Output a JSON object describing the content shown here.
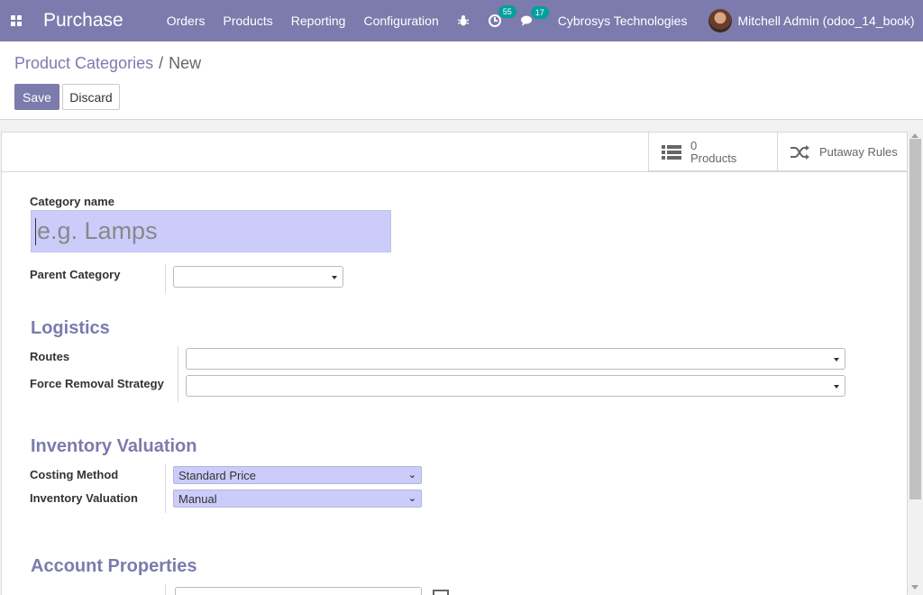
{
  "navbar": {
    "app_name": "Purchase",
    "menu": [
      "Orders",
      "Products",
      "Reporting",
      "Configuration"
    ],
    "activity_count": "55",
    "message_count": "17",
    "company": "Cybrosys Technologies",
    "user": "Mitchell Admin (odoo_14_book)"
  },
  "breadcrumb": {
    "parent": "Product Categories",
    "separator": "/",
    "current": "New"
  },
  "buttons": {
    "save": "Save",
    "discard": "Discard"
  },
  "smart_buttons": {
    "products_count": "0",
    "products_label": "Products",
    "putaway_label": "Putaway Rules"
  },
  "form": {
    "category_name_label": "Category name",
    "category_name_placeholder": "e.g. Lamps",
    "parent_category_label": "Parent Category",
    "logistics_title": "Logistics",
    "routes_label": "Routes",
    "force_removal_label": "Force Removal Strategy",
    "inventory_valuation_title": "Inventory Valuation",
    "costing_method_label": "Costing Method",
    "costing_method_value": "Standard Price",
    "inventory_valuation_label": "Inventory Valuation",
    "inventory_valuation_value": "Manual",
    "account_properties_title": "Account Properties"
  },
  "colors": {
    "brand": "#7c7bad",
    "badge": "#00a09d",
    "field_highlight": "#ccccfb"
  },
  "icons": [
    "apps-grid-icon",
    "bug-icon",
    "activity-icon",
    "chat-icon",
    "list-icon",
    "shuffle-icon",
    "external-link-icon"
  ]
}
